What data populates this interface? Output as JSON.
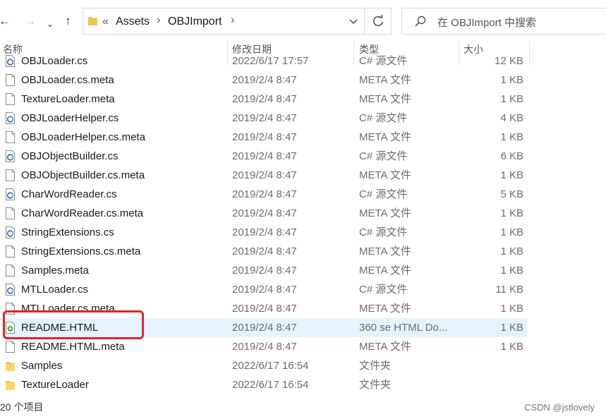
{
  "toolbar": {
    "breadcrumb_overflow": "«",
    "path": [
      "Assets",
      "OBJImport"
    ],
    "search_placeholder": "在 OBJImport 中搜索"
  },
  "columns": {
    "name": "名称",
    "date": "修改日期",
    "type": "类型",
    "size": "大小"
  },
  "partial_row": {
    "name": "OBJLoader.cs",
    "date": "2022/6/17 17:57",
    "type": "C# 源文件",
    "size": "12 KB"
  },
  "files": [
    {
      "name": "OBJLoader.cs.meta",
      "date": "2019/2/4 8:47",
      "type": "META 文件",
      "size": "1 KB",
      "icon": "file-icon"
    },
    {
      "name": "TextureLoader.meta",
      "date": "2019/2/4 8:47",
      "type": "META 文件",
      "size": "1 KB",
      "icon": "file-icon"
    },
    {
      "name": "OBJLoaderHelper.cs",
      "date": "2019/2/4 8:47",
      "type": "C# 源文件",
      "size": "4 KB",
      "icon": "csharp-file-icon"
    },
    {
      "name": "OBJLoaderHelper.cs.meta",
      "date": "2019/2/4 8:47",
      "type": "META 文件",
      "size": "1 KB",
      "icon": "file-icon"
    },
    {
      "name": "OBJObjectBuilder.cs",
      "date": "2019/2/4 8:47",
      "type": "C# 源文件",
      "size": "6 KB",
      "icon": "csharp-file-icon"
    },
    {
      "name": "OBJObjectBuilder.cs.meta",
      "date": "2019/2/4 8:47",
      "type": "META 文件",
      "size": "1 KB",
      "icon": "file-icon"
    },
    {
      "name": "CharWordReader.cs",
      "date": "2019/2/4 8:47",
      "type": "C# 源文件",
      "size": "5 KB",
      "icon": "csharp-file-icon"
    },
    {
      "name": "CharWordReader.cs.meta",
      "date": "2019/2/4 8:47",
      "type": "META 文件",
      "size": "1 KB",
      "icon": "file-icon"
    },
    {
      "name": "StringExtensions.cs",
      "date": "2019/2/4 8:47",
      "type": "C# 源文件",
      "size": "1 KB",
      "icon": "csharp-file-icon"
    },
    {
      "name": "StringExtensions.cs.meta",
      "date": "2019/2/4 8:47",
      "type": "META 文件",
      "size": "1 KB",
      "icon": "file-icon"
    },
    {
      "name": "Samples.meta",
      "date": "2019/2/4 8:47",
      "type": "META 文件",
      "size": "1 KB",
      "icon": "file-icon"
    },
    {
      "name": "MTLLoader.cs",
      "date": "2019/2/4 8:47",
      "type": "C# 源文件",
      "size": "11 KB",
      "icon": "csharp-file-icon"
    },
    {
      "name": "MTLLoader.cs.meta",
      "date": "2019/2/4 8:47",
      "type": "META 文件",
      "size": "1 KB",
      "icon": "file-icon"
    },
    {
      "name": "README.HTML",
      "date": "2019/2/4 8:47",
      "type": "360 se HTML Do...",
      "size": "1 KB",
      "icon": "html-file-icon",
      "selected": true
    },
    {
      "name": "README.HTML.meta",
      "date": "2019/2/4 8:47",
      "type": "META 文件",
      "size": "1 KB",
      "icon": "file-icon"
    },
    {
      "name": "Samples",
      "date": "2022/6/17 16:54",
      "type": "文件夹",
      "size": "",
      "icon": "folder-icon"
    },
    {
      "name": "TextureLoader",
      "date": "2022/6/17 16:54",
      "type": "文件夹",
      "size": "",
      "icon": "folder-icon"
    }
  ],
  "status": {
    "item_count": "20 个项目"
  },
  "watermark": "CSDN @jstlovely",
  "colors": {
    "selection": "#e5f3ff",
    "highlight": "#e2232a",
    "folder": "#f4c24b",
    "csharp": "#2b6cb0"
  }
}
